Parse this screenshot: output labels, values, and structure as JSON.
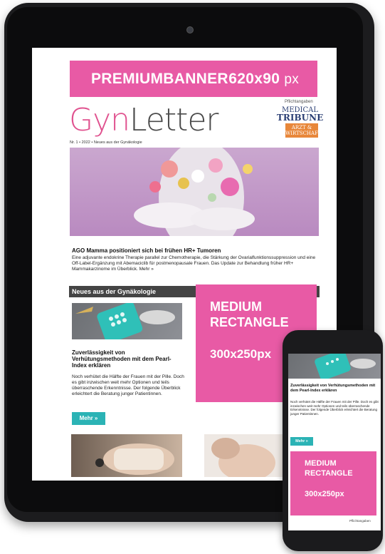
{
  "tablet": {
    "banner": {
      "label": "PREMIUMBANNER",
      "size": "620x90",
      "unit": "px"
    },
    "pflichtangaben": "Pflichtangaben",
    "logo": {
      "part1": "Gyn",
      "part2": "Letter"
    },
    "issue": "Nr. 1 • 2022 • Neues aus der Gynäkologie",
    "brand1": {
      "line1": "MEDICAL",
      "line2": "TRIBUNE"
    },
    "brand2": {
      "line1": "ARZT &",
      "line2": "WIRTSCHAFT"
    },
    "article": {
      "title": "AGO Mamma positioniert sich bei frühen HR+ Tumoren",
      "text": "Eine adjuvante endokrine Therapie parallel zur Chemotherapie, die Stärkung der Ovarialfunktionssuppression und eine Off-Label-Ergänzung mit Abemaciclib für postmenopausale Frauen. Das Update zur Behandlung früher HR+ Mammakarzinome im Überblick. Mehr »"
    },
    "section_title": "Neues aus der Gynäkologie",
    "card": {
      "title": "Zuverlässigkeit von Verhütungsmethoden mit dem Pearl-Index erklären",
      "text": "Noch verhütet die Hälfte der Frauen mit der Pille. Doch es gibt inzwischen weit mehr Optionen und teils überraschende Erkenntnisse. Der folgende Überblick erleichtert die Beratung junger Patientinnen.",
      "button": "Mehr »"
    },
    "rect_ad": {
      "line1": "MEDIUM",
      "line2": "RECTANGLE",
      "line3": "300x250",
      "unit": "px"
    }
  },
  "phone": {
    "card": {
      "title": "Zuverlässigkeit von Verhütungsmethoden mit dem Pearl-Index erklären",
      "text": "Noch verhütet die Hälfte der Frauen mit der Pille. Doch es gibt inzwischen weit mehr Optionen und teils überraschende Erkenntnisse. Der folgende Überblick erleichtert die Beratung junger Patientinnen.",
      "button": "Mehr »"
    },
    "rect_ad": {
      "line1": "MEDIUM",
      "line2": "RECTANGLE",
      "line3": "300x250",
      "unit": "px"
    },
    "pflichtangaben": "Pflichtangaben"
  },
  "colors": {
    "pink": "#e85aa5",
    "teal": "#2bb3b5",
    "section": "#444444",
    "logo_pink": "#e0528f",
    "brand_blue": "#2b3f74",
    "brand_orange": "#e8873a"
  }
}
